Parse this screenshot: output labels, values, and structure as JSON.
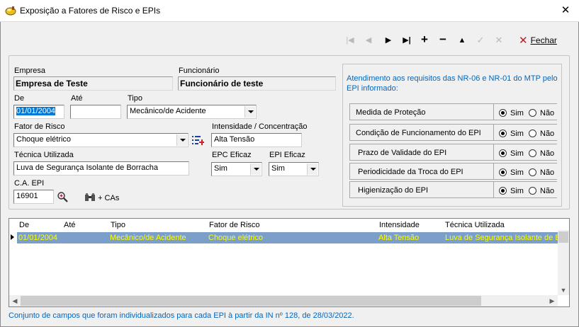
{
  "window": {
    "title": "Exposição a Fatores de Risco e EPIs",
    "close_label": "✕"
  },
  "toolbar": {
    "first": "|◀",
    "prev": "◀",
    "next": "▶",
    "last": "▶|",
    "add": "+",
    "remove": "−",
    "up": "▲",
    "confirm": "✓",
    "cancel": "✕",
    "fechar_label": "Fechar"
  },
  "form": {
    "empresa_label": "Empresa",
    "empresa_value": "Empresa de Teste",
    "funcionario_label": "Funcionário",
    "funcionario_value": "Funcionário de teste",
    "de_label": "De",
    "de_value": "01/01/2004",
    "ate_label": "Até",
    "ate_value": "",
    "tipo_label": "Tipo",
    "tipo_value": "Mecânico/de Acidente",
    "fator_label": "Fator de Risco",
    "fator_value": "Choque elétrico",
    "intensidade_label": "Intensidade / Concentração",
    "intensidade_value": "Alta Tensão",
    "tecnica_label": "Técnica Utilizada",
    "tecnica_value": "Luva de Segurança Isolante de Borracha",
    "epc_label": "EPC Eficaz",
    "epc_value": "Sim",
    "epi_label": "EPI Eficaz",
    "epi_value": "Sim",
    "ca_label": "C.A. EPI",
    "ca_value": "16901",
    "cas_label": "+ CAs"
  },
  "requirements": {
    "title": "Atendimento aos requisitos das NR-06 e NR-01 do MTP pelo EPI informado:",
    "sim_label": "Sim",
    "nao_label": "Não",
    "items": [
      {
        "label": "Medida de Proteção",
        "value": "Sim"
      },
      {
        "label": "Condição de Funcionamento do EPI",
        "value": "Sim"
      },
      {
        "label": "Prazo de Validade do EPI",
        "value": "Sim"
      },
      {
        "label": "Periodicidade da Troca do EPI",
        "value": "Sim"
      },
      {
        "label": "Higienização do EPI",
        "value": "Sim"
      }
    ]
  },
  "grid": {
    "columns": [
      "De",
      "Até",
      "Tipo",
      "Fator de Risco",
      "Intensidade",
      "Técnica Utilizada"
    ],
    "rows": [
      [
        "01/01/2004",
        "",
        "Mecânico/de Acidente",
        "Choque elétrico",
        "Alta Tensão",
        "Luva de Segurança Isolante de Borracha"
      ]
    ]
  },
  "footnote": "Conjunto de campos que foram individualizados para cada EPI à partir da IN nº 128, de 28/03/2022.",
  "colors": {
    "accent_text": "#0067c0",
    "selected_row_bg": "#7b9fc8",
    "selected_row_text": "#ffff00",
    "close_icon": "#c8161d"
  }
}
